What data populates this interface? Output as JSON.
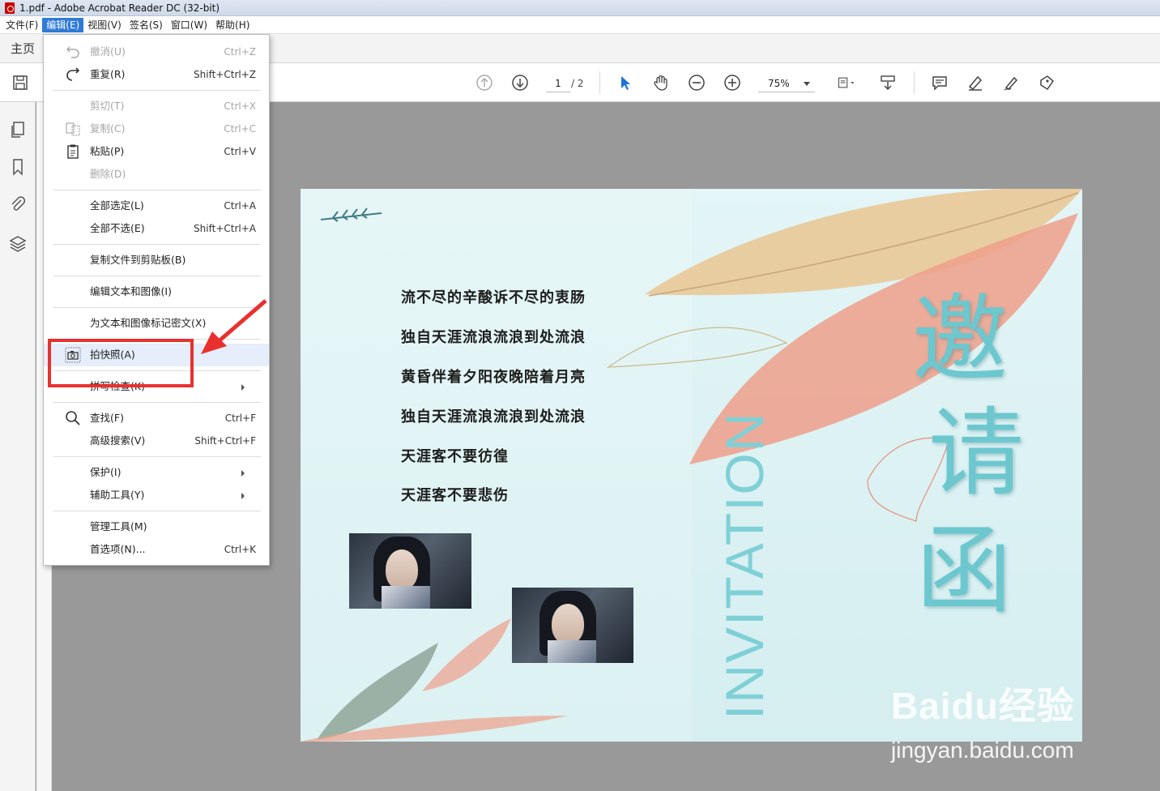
{
  "window": {
    "title": "1.pdf - Adobe Acrobat Reader DC (32-bit)"
  },
  "menubar": [
    "文件(F)",
    "编辑(E)",
    "视图(V)",
    "签名(S)",
    "窗口(W)",
    "帮助(H)"
  ],
  "tabs": {
    "home": "主页"
  },
  "toolbar": {
    "page_current": "1",
    "page_total": "/ 2",
    "zoom": "75%"
  },
  "edit_menu": {
    "undo": {
      "label": "撤消(U)",
      "shortcut": "Ctrl+Z"
    },
    "redo": {
      "label": "重复(R)",
      "shortcut": "Shift+Ctrl+Z"
    },
    "cut": {
      "label": "剪切(T)",
      "shortcut": "Ctrl+X"
    },
    "copy": {
      "label": "复制(C)",
      "shortcut": "Ctrl+C"
    },
    "paste": {
      "label": "粘贴(P)",
      "shortcut": "Ctrl+V"
    },
    "delete": {
      "label": "删除(D)"
    },
    "select_all": {
      "label": "全部选定(L)",
      "shortcut": "Ctrl+A"
    },
    "deselect_all": {
      "label": "全部不选(E)",
      "shortcut": "Shift+Ctrl+A"
    },
    "copy_file": {
      "label": "复制文件到剪贴板(B)"
    },
    "edit_text": {
      "label": "编辑文本和图像(I)"
    },
    "redact": {
      "label": "为文本和图像标记密文(X)"
    },
    "snapshot": {
      "label": "拍快照(A)"
    },
    "spell_check": {
      "label": "拼写检查(K)"
    },
    "find": {
      "label": "查找(F)",
      "shortcut": "Ctrl+F"
    },
    "advanced_search": {
      "label": "高级搜索(V)",
      "shortcut": "Shift+Ctrl+F"
    },
    "protection": {
      "label": "保护(I)"
    },
    "accessibility": {
      "label": "辅助工具(Y)"
    },
    "manage_tools": {
      "label": "管理工具(M)"
    },
    "preferences": {
      "label": "首选项(N)...",
      "shortcut": "Ctrl+K"
    }
  },
  "document": {
    "poem_lines": [
      "流不尽的辛酸诉不尽的衷肠",
      "独自天涯流浪流浪到处流浪",
      "黄昏伴着夕阳夜晚陪着月亮",
      "独自天涯流浪流浪到处流浪",
      "天涯客不要彷徨",
      "天涯客不要悲伤"
    ],
    "vertical_text": "INVITATION",
    "title_chars": [
      "邀",
      "请",
      "函"
    ]
  },
  "watermark": {
    "brand": "Baidu经验",
    "url": "jingyan.baidu.com"
  },
  "colors": {
    "menu_highlight": "#2f7bd8",
    "annotation_red": "#e8312f",
    "invite_teal": "#6cc7cf"
  }
}
